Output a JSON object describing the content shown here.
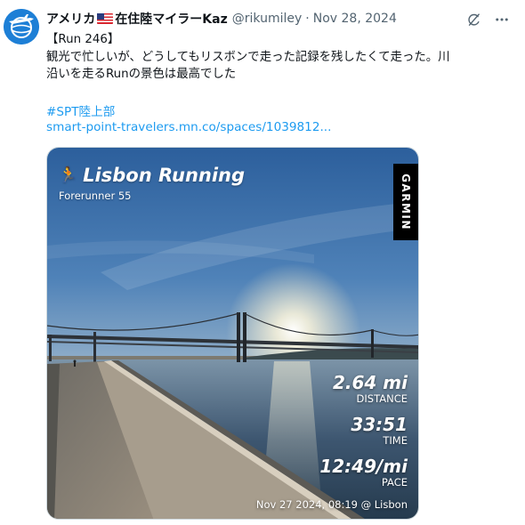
{
  "tweet": {
    "display_name_left": "アメリカ",
    "display_name_right": "在住陸マイラーKaz",
    "handle": "@rikumiley",
    "separator": "·",
    "date": "Nov 28, 2024",
    "text_line1": "【Run 246】",
    "text_line2": "観光で忙しいが、どうしてもリスボンで走った記録を残したくて走った。川",
    "text_line3": "沿いを走るRunの景色は最高でした",
    "hashtag": "#SPT陸上部",
    "link": "smart-point-travelers.mn.co/spaces/1039812..."
  },
  "icons": {
    "avatar": "airplane-globe-logo",
    "flag": "us-flag-emoji",
    "grok": "grok-icon",
    "more": "more-icon",
    "runner": "runner-icon"
  },
  "media": {
    "title": "Lisbon Running",
    "device": "Forerunner 55",
    "brand": "GARMIN",
    "distance_value": "2.64 mi",
    "distance_label": "DISTANCE",
    "time_value": "33:51",
    "time_label": "TIME",
    "pace_value": "12:49/mi",
    "pace_label": "PACE",
    "caption": "Nov 27 2024, 08:19 @ Lisbon"
  },
  "colors": {
    "link": "#1d9bf0",
    "secondary_text": "#536471",
    "avatar_bg": "#1d7fd6"
  }
}
